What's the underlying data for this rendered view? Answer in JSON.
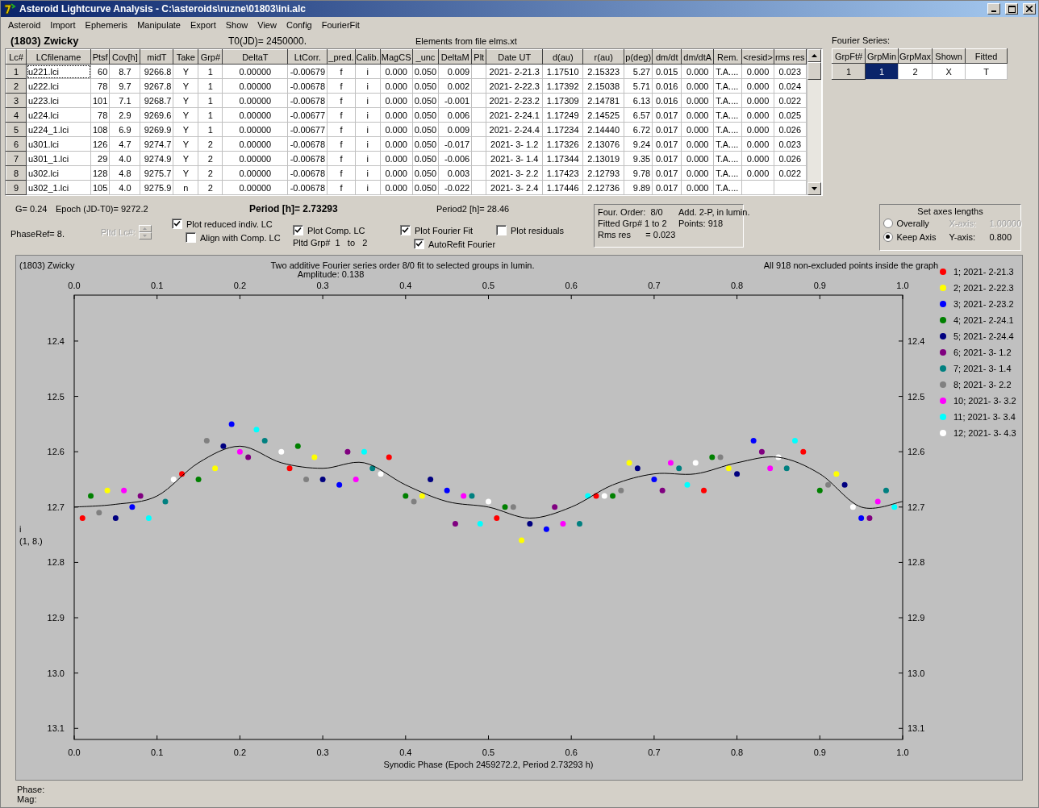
{
  "window": {
    "title": "Asteroid Lightcurve Analysis - C:\\asteroids\\ruzne\\01803\\ini.alc"
  },
  "menu": [
    "Asteroid",
    "Import",
    "Ephemeris",
    "Manipulate",
    "Export",
    "Show",
    "View",
    "Config",
    "FourierFit"
  ],
  "header": {
    "asteroid": "(1803) Zwicky",
    "t0": "T0(JD)= 2450000.",
    "elements": "Elements from file elms.xt"
  },
  "table": {
    "columns": [
      "Lc#",
      "LCfilename",
      "Ptsf",
      "Cov[h]",
      "midT",
      "Take",
      "Grp#",
      "DeltaT",
      "LtCorr.",
      "_pred.",
      "Calib.",
      "MagCS",
      "_unc",
      "DeltaM",
      "Plt",
      "Date UT",
      "d(au)",
      "r(au)",
      "p(deg)",
      "dm/dt",
      "dm/dtA",
      "Rem.",
      "<resid>",
      "rms res"
    ],
    "rows": [
      {
        "focused": true,
        "cells": [
          "1",
          "u221.lci",
          "60",
          "8.7",
          "9266.8",
          "Y",
          "1",
          "0.00000",
          "-0.00679",
          "f",
          "i",
          "0.000",
          "0.050",
          "0.009",
          null,
          "2021- 2-21.3",
          "1.17510",
          "2.15323",
          "5.27",
          "0.015",
          "0.000",
          "T.A....",
          "0.000",
          "0.023"
        ]
      },
      {
        "focused": false,
        "cells": [
          "2",
          "u222.lci",
          "78",
          "9.7",
          "9267.8",
          "Y",
          "1",
          "0.00000",
          "-0.00678",
          "f",
          "i",
          "0.000",
          "0.050",
          "0.002",
          null,
          "2021- 2-22.3",
          "1.17392",
          "2.15038",
          "5.71",
          "0.016",
          "0.000",
          "T.A....",
          "0.000",
          "0.024"
        ]
      },
      {
        "focused": false,
        "cells": [
          "3",
          "u223.lci",
          "101",
          "7.1",
          "9268.7",
          "Y",
          "1",
          "0.00000",
          "-0.00678",
          "f",
          "i",
          "0.000",
          "0.050",
          "-0.001",
          null,
          "2021- 2-23.2",
          "1.17309",
          "2.14781",
          "6.13",
          "0.016",
          "0.000",
          "T.A....",
          "0.000",
          "0.022"
        ]
      },
      {
        "focused": false,
        "cells": [
          "4",
          "u224.lci",
          "78",
          "2.9",
          "9269.6",
          "Y",
          "1",
          "0.00000",
          "-0.00677",
          "f",
          "i",
          "0.000",
          "0.050",
          "0.006",
          null,
          "2021- 2-24.1",
          "1.17249",
          "2.14525",
          "6.57",
          "0.017",
          "0.000",
          "T.A....",
          "0.000",
          "0.025"
        ]
      },
      {
        "focused": false,
        "cells": [
          "5",
          "u224_1.lci",
          "108",
          "6.9",
          "9269.9",
          "Y",
          "1",
          "0.00000",
          "-0.00677",
          "f",
          "i",
          "0.000",
          "0.050",
          "0.009",
          null,
          "2021- 2-24.4",
          "1.17234",
          "2.14440",
          "6.72",
          "0.017",
          "0.000",
          "T.A....",
          "0.000",
          "0.026"
        ]
      },
      {
        "focused": false,
        "cells": [
          "6",
          "u301.lci",
          "126",
          "4.7",
          "9274.7",
          "Y",
          "2",
          "0.00000",
          "-0.00678",
          "f",
          "i",
          "0.000",
          "0.050",
          "-0.017",
          null,
          "2021- 3- 1.2",
          "1.17326",
          "2.13076",
          "9.24",
          "0.017",
          "0.000",
          "T.A....",
          "0.000",
          "0.023"
        ]
      },
      {
        "focused": false,
        "cells": [
          "7",
          "u301_1.lci",
          "29",
          "4.0",
          "9274.9",
          "Y",
          "2",
          "0.00000",
          "-0.00678",
          "f",
          "i",
          "0.000",
          "0.050",
          "-0.006",
          null,
          "2021- 3- 1.4",
          "1.17344",
          "2.13019",
          "9.35",
          "0.017",
          "0.000",
          "T.A....",
          "0.000",
          "0.026"
        ]
      },
      {
        "focused": false,
        "cells": [
          "8",
          "u302.lci",
          "128",
          "4.8",
          "9275.7",
          "Y",
          "2",
          "0.00000",
          "-0.00678",
          "f",
          "i",
          "0.000",
          "0.050",
          "0.003",
          null,
          "2021- 3- 2.2",
          "1.17423",
          "2.12793",
          "9.78",
          "0.017",
          "0.000",
          "T.A....",
          "0.000",
          "0.022"
        ]
      },
      {
        "focused": false,
        "cells": [
          "9",
          "u302_1.lci",
          "105",
          "4.0",
          "9275.9",
          "n",
          "2",
          "0.00000",
          "-0.00678",
          "f",
          "i",
          "0.000",
          "0.050",
          "-0.022",
          null,
          "2021- 3- 2.4",
          "1.17446",
          "2.12736",
          "9.89",
          "0.017",
          "0.000",
          "T.A....",
          null,
          null
        ]
      }
    ]
  },
  "fourier_series": {
    "label": "Fourier Series:",
    "columns": [
      "GrpFt#",
      "GrpMin",
      "GrpMax",
      "Shown",
      "Fitted"
    ],
    "rows": [
      {
        "cells": [
          {
            "text": "1",
            "selected": false
          },
          {
            "text": "1",
            "selected": true
          },
          {
            "text": "2",
            "selected": false
          },
          {
            "text": "X",
            "selected": false
          },
          {
            "text": "T",
            "selected": false
          }
        ]
      }
    ]
  },
  "params": {
    "g": "G= 0.24",
    "epoch": "Epoch (JD-T0)= 9272.2",
    "period": "Period [h]= 2.73293",
    "period2": "Period2 [h]= 28.46",
    "phase_ref": "PhaseRef= 8.",
    "pltd_lc": {
      "label": "Pltd Lc#:",
      "disabled": true
    },
    "pltd_grp": "Pltd Grp#  1   to   2"
  },
  "checkboxes": [
    {
      "label": "Plot reduced indiv. LC",
      "checked": true
    },
    {
      "label": "Align with Comp. LC",
      "checked": false
    },
    {
      "label": "Plot Comp. LC",
      "checked": true
    },
    {
      "label": "Plot Fourier Fit",
      "checked": true
    },
    {
      "label": "AutoRefit Fourier",
      "checked": true
    },
    {
      "label": "Plot residuals",
      "checked": false
    }
  ],
  "fit_info": [
    "Four. Order:  8/0",
    "Add. 2-P, in lumin.",
    "Fitted Grp# 1 to 2",
    "Points: 918",
    "Rms res      = 0.023"
  ],
  "axes": {
    "title": "Set axes lengths",
    "options": [
      {
        "label": "Overally",
        "selected": false
      },
      {
        "label": "Keep Axis",
        "selected": true
      }
    ],
    "fields": [
      {
        "label": "X-axis:",
        "value": "1.00000",
        "disabled": true
      },
      {
        "label": "Y-axis:",
        "value": "0.800",
        "disabled": false
      }
    ]
  },
  "chart": {
    "object": "(1803) Zwicky",
    "subtitle": "Amplitude: 0.138",
    "note": "All 918 non-excluded points inside the graph",
    "chart_data": {
      "type": "scatter",
      "title": "Two additive Fourier series order 8/0 fit to selected groups in lumin.",
      "xlabel": "Synodic Phase (Epoch 2459272.2, Period 2.73293 h)",
      "legend": "right",
      "annotations": [
        {
          "text": "i"
        },
        {
          "text": "(1, 8.)"
        }
      ],
      "xlim": [
        0,
        1
      ],
      "ylim": [
        13.12,
        12.317
      ],
      "xticks": [
        {
          "value": 0,
          "label": "0.0"
        },
        {
          "value": 0.1,
          "label": "0.1"
        },
        {
          "value": 0.2,
          "label": "0.2"
        },
        {
          "value": 0.3,
          "label": "0.3"
        },
        {
          "value": 0.4,
          "label": "0.4"
        },
        {
          "value": 0.5,
          "label": "0.5"
        },
        {
          "value": 0.6,
          "label": "0.6"
        },
        {
          "value": 0.7,
          "label": "0.7"
        },
        {
          "value": 0.8,
          "label": "0.8"
        },
        {
          "value": 0.9,
          "label": "0.9"
        },
        {
          "value": 1,
          "label": "1.0"
        }
      ],
      "yticks": [
        {
          "value": 12.4,
          "label": "12.4"
        },
        {
          "value": 12.5,
          "label": "12.5"
        },
        {
          "value": 12.6,
          "label": "12.6"
        },
        {
          "value": 12.7,
          "label": "12.7"
        },
        {
          "value": 12.8,
          "label": "12.8"
        },
        {
          "value": 12.9,
          "label": "12.9"
        },
        {
          "value": 13.0,
          "label": "13.0"
        },
        {
          "value": 13.1,
          "label": "13.1"
        }
      ],
      "series": [
        {
          "name": "1; 2021- 2-21.3",
          "color": "#ff0000",
          "x": [
            0.01,
            0.13,
            0.26,
            0.38,
            0.51,
            0.63,
            0.76,
            0.88
          ],
          "values": [
            12.72,
            12.64,
            12.63,
            12.61,
            12.72,
            12.68,
            12.67,
            12.6
          ]
        },
        {
          "name": "2; 2021- 2-22.3",
          "color": "#ffff00",
          "x": [
            0.04,
            0.17,
            0.29,
            0.42,
            0.54,
            0.67,
            0.79,
            0.92
          ],
          "values": [
            12.67,
            12.63,
            12.61,
            12.68,
            12.76,
            12.62,
            12.63,
            12.64
          ]
        },
        {
          "name": "3; 2021- 2-23.2",
          "color": "#0000ff",
          "x": [
            0.07,
            0.19,
            0.32,
            0.45,
            0.57,
            0.7,
            0.82,
            0.95
          ],
          "values": [
            12.7,
            12.55,
            12.66,
            12.67,
            12.74,
            12.65,
            12.58,
            12.72
          ]
        },
        {
          "name": "4; 2021- 2-24.1",
          "color": "#008000",
          "x": [
            0.02,
            0.15,
            0.27,
            0.4,
            0.52,
            0.65,
            0.77,
            0.9
          ],
          "values": [
            12.68,
            12.65,
            12.59,
            12.68,
            12.7,
            12.68,
            12.61,
            12.67
          ]
        },
        {
          "name": "5; 2021- 2-24.4",
          "color": "#000080",
          "x": [
            0.05,
            0.18,
            0.3,
            0.43,
            0.55,
            0.68,
            0.8,
            0.93
          ],
          "values": [
            12.72,
            12.59,
            12.65,
            12.65,
            12.73,
            12.63,
            12.64,
            12.66
          ]
        },
        {
          "name": "6; 2021- 3- 1.2",
          "color": "#800080",
          "x": [
            0.08,
            0.21,
            0.33,
            0.46,
            0.58,
            0.71,
            0.83,
            0.96
          ],
          "values": [
            12.68,
            12.61,
            12.6,
            12.73,
            12.7,
            12.67,
            12.6,
            12.72
          ]
        },
        {
          "name": "7; 2021- 3- 1.4",
          "color": "#008080",
          "x": [
            0.11,
            0.23,
            0.36,
            0.48,
            0.61,
            0.73,
            0.86,
            0.98
          ],
          "values": [
            12.69,
            12.58,
            12.63,
            12.68,
            12.73,
            12.63,
            12.63,
            12.67
          ]
        },
        {
          "name": "8; 2021- 3- 2.2",
          "color": "#808080",
          "x": [
            0.03,
            0.16,
            0.28,
            0.41,
            0.53,
            0.66,
            0.78,
            0.91
          ],
          "values": [
            12.71,
            12.58,
            12.65,
            12.69,
            12.7,
            12.67,
            12.61,
            12.66
          ]
        },
        {
          "name": "10; 2021- 3- 3.2",
          "color": "#ff00ff",
          "x": [
            0.06,
            0.2,
            0.34,
            0.47,
            0.59,
            0.72,
            0.84,
            0.97
          ],
          "values": [
            12.67,
            12.6,
            12.65,
            12.68,
            12.73,
            12.62,
            12.63,
            12.69
          ]
        },
        {
          "name": "11; 2021- 3- 3.4",
          "color": "#00ffff",
          "x": [
            0.09,
            0.22,
            0.35,
            0.49,
            0.62,
            0.74,
            0.87,
            0.99
          ],
          "values": [
            12.72,
            12.56,
            12.6,
            12.73,
            12.68,
            12.66,
            12.58,
            12.7
          ]
        },
        {
          "name": "12; 2021- 3- 4.3",
          "color": "#ffffff",
          "x": [
            0.12,
            0.25,
            0.37,
            0.5,
            0.64,
            0.75,
            0.85,
            0.94
          ],
          "values": [
            12.65,
            12.6,
            12.64,
            12.69,
            12.68,
            12.62,
            12.61,
            12.7
          ]
        },
        {
          "type": "line",
          "color": "#000000",
          "x": [
            0,
            0.05,
            0.1,
            0.15,
            0.2,
            0.25,
            0.3,
            0.35,
            0.4,
            0.45,
            0.5,
            0.55,
            0.6,
            0.65,
            0.7,
            0.75,
            0.8,
            0.85,
            0.9,
            0.95,
            1
          ],
          "values": [
            12.7,
            12.695,
            12.68,
            12.62,
            12.59,
            12.62,
            12.63,
            12.62,
            12.66,
            12.69,
            12.7,
            12.72,
            12.7,
            12.66,
            12.64,
            12.64,
            12.62,
            12.61,
            12.64,
            12.7,
            12.69
          ]
        }
      ]
    }
  },
  "status": [
    "Phase:",
    "Mag:"
  ]
}
